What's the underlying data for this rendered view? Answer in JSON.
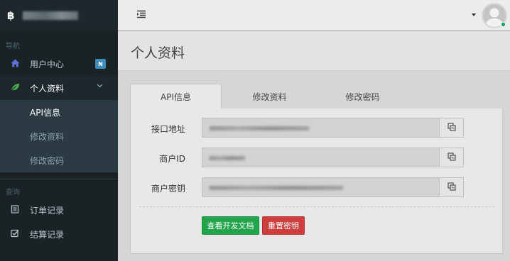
{
  "sidebar": {
    "brand_icon": "bitcoin-icon",
    "nav_section": "导航",
    "query_section": "查询",
    "items": [
      {
        "label": "用户中心",
        "icon": "home-icon",
        "badge": "N"
      },
      {
        "label": "个人资料",
        "icon": "leaf-icon"
      },
      {
        "label": "订单记录",
        "icon": "list-icon"
      },
      {
        "label": "结算记录",
        "icon": "check-square-icon"
      }
    ],
    "subitems": [
      {
        "label": "API信息"
      },
      {
        "label": "修改资料"
      },
      {
        "label": "修改密码"
      }
    ]
  },
  "header": {
    "menu_icon": "menu-toggle-icon",
    "avatar_icon": "user-avatar-icon"
  },
  "main": {
    "page_title": "个人资料",
    "tabs": [
      {
        "label": "API信息",
        "active": true
      },
      {
        "label": "修改资料",
        "active": false
      },
      {
        "label": "修改密码",
        "active": false
      }
    ],
    "fields": [
      {
        "label": "接口地址"
      },
      {
        "label": "商户ID"
      },
      {
        "label": "商户密钥"
      }
    ],
    "buttons": {
      "docs": "查看开发文档",
      "reset": "重置密钥"
    }
  },
  "colors": {
    "sidebar_bg": "#1a2226",
    "accent_blue": "#3c8dbc",
    "success_green": "#22a54a",
    "danger_red": "#cf3d3d",
    "online_green": "#00a65a"
  }
}
